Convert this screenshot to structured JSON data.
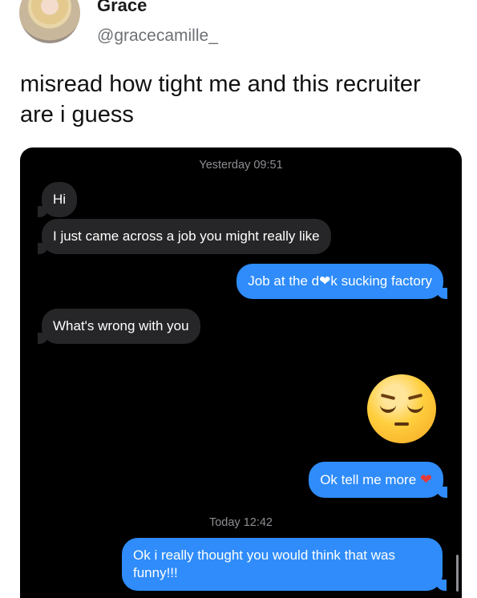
{
  "tweet": {
    "name": "Grace",
    "handle": "@gracecamille_",
    "text": "misread how tight me and this recruiter are i guess"
  },
  "chat": {
    "timestamp_1": "Yesterday 09:51",
    "messages": [
      {
        "side": "in",
        "text": "Hi"
      },
      {
        "side": "in",
        "text": "I just came across a job you might really like"
      },
      {
        "side": "out",
        "text": "Job at the d❤k sucking factory"
      },
      {
        "side": "in",
        "text": "What's wrong with you"
      },
      {
        "side": "out",
        "text": "Ok tell me more"
      },
      {
        "side": "out",
        "text": "Ok i really thought you would think that was funny!!!"
      }
    ],
    "emoji_name": "pensive-face-emoji",
    "timestamp_2": "Today 12:42"
  },
  "colors": {
    "incoming_bubble": "#262628",
    "outgoing_bubble": "#2f8cfa",
    "chat_background": "#000000"
  }
}
